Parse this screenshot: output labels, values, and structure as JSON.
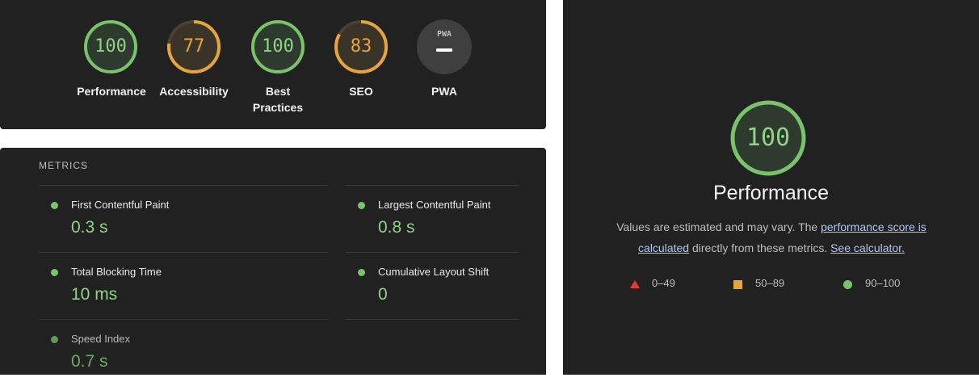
{
  "scores": [
    {
      "label": "Performance",
      "score": "100",
      "value": 100,
      "color": "#79c36b"
    },
    {
      "label": "Accessibility",
      "score": "77",
      "value": 77,
      "color": "#e6a53a"
    },
    {
      "label": "Best Practices",
      "score": "100",
      "value": 100,
      "color": "#79c36b"
    },
    {
      "label": "SEO",
      "score": "83",
      "value": 83,
      "color": "#e6a53a"
    },
    {
      "label": "PWA",
      "badge_text": "PWA"
    }
  ],
  "metrics": {
    "title": "METRICS",
    "items": [
      {
        "name": "First Contentful Paint",
        "value": "0.3 s"
      },
      {
        "name": "Largest Contentful Paint",
        "value": "0.8 s"
      },
      {
        "name": "Total Blocking Time",
        "value": "10 ms"
      },
      {
        "name": "Cumulative Layout Shift",
        "value": "0"
      },
      {
        "name": "Speed Index",
        "value": "0.7 s"
      }
    ]
  },
  "performance": {
    "score": "100",
    "title": "Performance",
    "desc_prefix": "Values are estimated and may vary. The ",
    "link1": "performance score is calculated",
    "desc_middle": " directly from these metrics. ",
    "link2": "See calculator.",
    "legend": [
      {
        "range": "0–49",
        "shape": "triangle",
        "color": "#e53935"
      },
      {
        "range": "50–89",
        "shape": "square",
        "color": "#e6a53a"
      },
      {
        "range": "90–100",
        "shape": "circle",
        "color": "#79c36b"
      }
    ]
  },
  "colors": {
    "pass": "#79c36b",
    "average": "#e6a53a",
    "fail": "#e53935",
    "panel": "#212121"
  }
}
